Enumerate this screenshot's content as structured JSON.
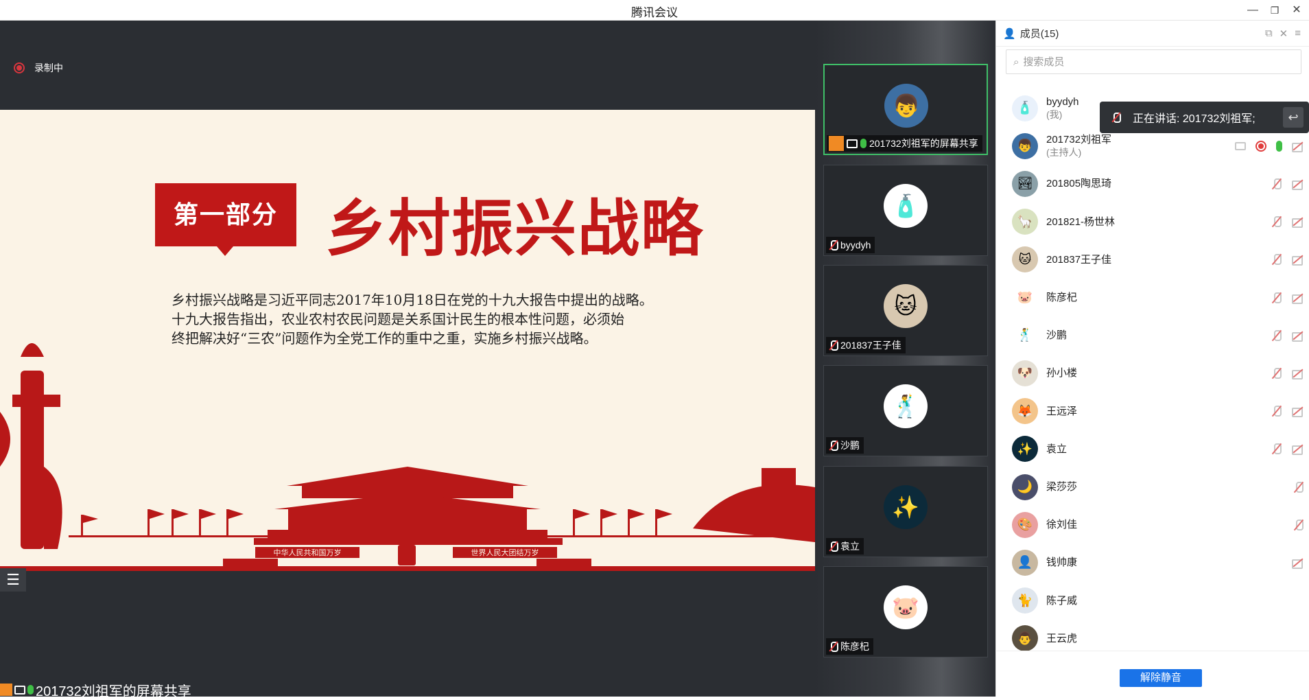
{
  "window": {
    "title": "腾讯会议"
  },
  "recording": {
    "label": "录制中"
  },
  "slide": {
    "badge": "第一部分",
    "headline": "乡村振兴战略",
    "paragraph_lines": [
      "乡村振兴战略是习近平同志2017年10月18日在党的十九大报告中提出的战略。",
      "十九大报告指出，农业农村农民问题是关系国计民生的根本性问题，必须始",
      "终把解决好“三农”问题作为全党工作的重中之重，实施乡村振兴战略。"
    ],
    "banner_left": "中华人民共和国万岁",
    "banner_right": "世界人民大团结万岁"
  },
  "share_label": "201732刘祖军的屏幕共享",
  "gallery": [
    {
      "name": "201732刘祖军的屏幕共享",
      "avatar_icon": "boy-avatar-icon",
      "glyph": "👦",
      "bg": "#3d6fa3",
      "active": true
    },
    {
      "name": "byydyh",
      "avatar_icon": "bottle-avatar-icon",
      "glyph": "🧴",
      "bg": "#ffffff",
      "active": false
    },
    {
      "name": "201837王子佳",
      "avatar_icon": "cat-avatar-icon",
      "glyph": "🐱",
      "bg": "#d8c8b0",
      "active": false
    },
    {
      "name": "沙鹏",
      "avatar_icon": "figure-avatar-icon",
      "glyph": "🕺",
      "bg": "#ffffff",
      "active": false
    },
    {
      "name": "袁立",
      "avatar_icon": "galaxy-avatar-icon",
      "glyph": "✨",
      "bg": "#0c2a3a",
      "active": false
    },
    {
      "name": "陈彦杞",
      "avatar_icon": "pig-avatar-icon",
      "glyph": "🐷",
      "bg": "#ffffff",
      "active": false
    }
  ],
  "members_panel": {
    "title": "成员(15)",
    "search_placeholder": "搜索成员",
    "speaking_text": "正在讲话: 201732刘祖军;",
    "unmute_button": "解除静音",
    "members": [
      {
        "name": "byydyh",
        "sub": "(我)",
        "glyph": "🧴",
        "bg": "#e9f1fb",
        "icons": []
      },
      {
        "name": "201732刘祖军",
        "sub": "(主持人)",
        "glyph": "👦",
        "bg": "#3d6fa3",
        "icons": [
          "share",
          "rec",
          "mic-on",
          "cam-off"
        ]
      },
      {
        "name": "201805陶思琦",
        "sub": "",
        "glyph": "🏞",
        "bg": "#8aa0a8",
        "icons": [
          "mic-off",
          "cam-off"
        ]
      },
      {
        "name": "201821-杨世林",
        "sub": "",
        "glyph": "🦙",
        "bg": "#d9e2c0",
        "icons": [
          "mic-off",
          "cam-off"
        ]
      },
      {
        "name": "201837王子佳",
        "sub": "",
        "glyph": "🐱",
        "bg": "#d8c8b0",
        "icons": [
          "mic-off",
          "cam-off"
        ]
      },
      {
        "name": "陈彦杞",
        "sub": "",
        "glyph": "🐷",
        "bg": "#ffffff",
        "icons": [
          "mic-off",
          "cam-off"
        ]
      },
      {
        "name": "沙鹏",
        "sub": "",
        "glyph": "🕺",
        "bg": "#ffffff",
        "icons": [
          "mic-off",
          "cam-off"
        ]
      },
      {
        "name": "孙小楼",
        "sub": "",
        "glyph": "🐶",
        "bg": "#e5e0d5",
        "icons": [
          "mic-off",
          "cam-off"
        ]
      },
      {
        "name": "王远泽",
        "sub": "",
        "glyph": "🦊",
        "bg": "#f3c48a",
        "icons": [
          "mic-off",
          "cam-off"
        ]
      },
      {
        "name": "袁立",
        "sub": "",
        "glyph": "✨",
        "bg": "#0c2a3a",
        "icons": [
          "mic-off",
          "cam-off"
        ]
      },
      {
        "name": "梁莎莎",
        "sub": "",
        "glyph": "🌙",
        "bg": "#4a4e6a",
        "icons": [
          "mic-off"
        ]
      },
      {
        "name": "徐刘佳",
        "sub": "",
        "glyph": "🎨",
        "bg": "#e9a0a0",
        "icons": [
          "mic-off"
        ]
      },
      {
        "name": "钱帅康",
        "sub": "",
        "glyph": "👤",
        "bg": "#c8b8a0",
        "icons": [
          "cam-off"
        ]
      },
      {
        "name": "陈子威",
        "sub": "",
        "glyph": "🐈",
        "bg": "#dfe6ee",
        "icons": []
      },
      {
        "name": "王云虎",
        "sub": "",
        "glyph": "👨",
        "bg": "#5a5040",
        "icons": []
      }
    ]
  },
  "colors": {
    "accent_red": "#c01818",
    "brand_blue": "#1a73e8",
    "speaking_green": "#3fbf46"
  }
}
